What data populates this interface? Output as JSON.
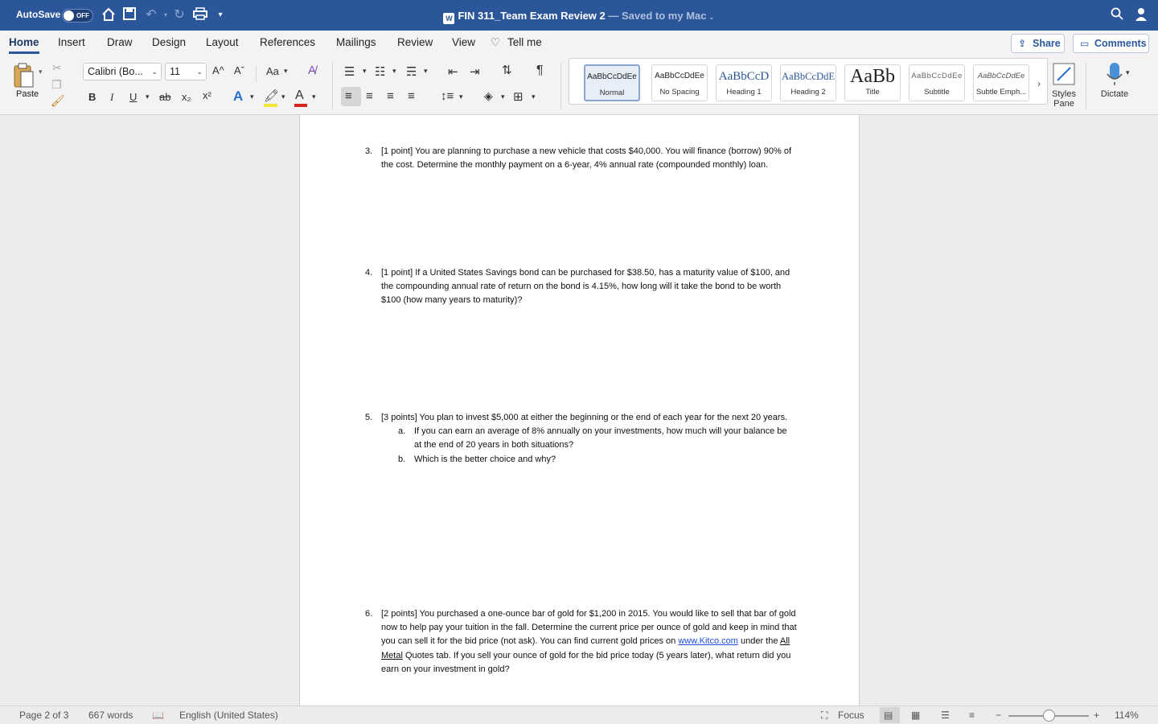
{
  "titlebar": {
    "autosave_label": "AutoSave",
    "toggle_state": "OFF",
    "doc_name": "FIN 311_Team Exam Review 2",
    "doc_status": "— Saved to my Mac",
    "icons": [
      "home-icon",
      "save-icon",
      "undo-icon",
      "redo-icon",
      "print-icon",
      "customize-icon",
      "search-icon",
      "account-icon"
    ]
  },
  "menu": {
    "tabs": [
      "Home",
      "Insert",
      "Draw",
      "Design",
      "Layout",
      "References",
      "Mailings",
      "Review",
      "View",
      "Tell me"
    ],
    "active": "Home",
    "share_label": "Share",
    "comments_label": "Comments"
  },
  "ribbon": {
    "paste_label": "Paste",
    "font_name": "Calibri (Bo...",
    "font_size": "11",
    "grow_font": "A^",
    "shrink_font": "Aˇ",
    "change_case": "Aa",
    "bold": "B",
    "italic": "I",
    "underline": "U",
    "strike": "ab",
    "subscript": "x₂",
    "superscript": "x²",
    "pilcrow": "¶",
    "styles": [
      {
        "sample": "AaBbCcDdEe",
        "name": "Normal"
      },
      {
        "sample": "AaBbCcDdEe",
        "name": "No Spacing"
      },
      {
        "sample": "AaBbCcD",
        "name": "Heading 1"
      },
      {
        "sample": "AaBbCcDdE",
        "name": "Heading 2"
      },
      {
        "sample": "AaBb",
        "name": "Title"
      },
      {
        "sample": "AaBbCcDdEe",
        "name": "Subtitle"
      },
      {
        "sample": "AaBbCcDdEe",
        "name": "Subtle Emph..."
      }
    ],
    "styles_pane_label": "Styles Pane",
    "dictate_label": "Dictate",
    "colors": {
      "accent": "#2b579a",
      "highlight": "#f5e43a",
      "font_color": "#d9261c"
    }
  },
  "document": {
    "q3": {
      "num": "3.",
      "text": "[1 point] You are planning to purchase a new vehicle that costs $40,000.  You will finance (borrow) 90% of the cost.  Determine the monthly payment on a 6-year, 4% annual rate (compounded monthly) loan."
    },
    "q4": {
      "num": "4.",
      "text": "[1 point] If a United States Savings bond can be purchased for $38.50, has a maturity value of $100, and the compounding annual rate of return on the bond is 4.15%, how long will it take the bond to be worth $100 (how many years to maturity)?"
    },
    "q5": {
      "num": "5.",
      "text": "[3 points] You plan to invest $5,000 at either the beginning or the end of each year for the next 20 years.",
      "a_label": "a.",
      "a_text": "If you can earn an average of 8% annually on your investments, how much will your balance be at the end of 20 years in both situations?",
      "b_label": "b.",
      "b_text": "Which is the better choice and why?"
    },
    "q6": {
      "num": "6.",
      "text_part1": "[2 points] You purchased a one-ounce bar of gold for $1,200 in 2015. You would like to sell that bar of gold now to help pay your tuition in the fall. Determine the current price per ounce of gold and keep in mind that you can sell it for the bid price (not ask). You can find current gold prices on",
      "link_text": "www.Kitco.com",
      "text_part2": "under the",
      "underlined_text": "All Metal",
      "text_part3": "Quotes tab. If you sell your ounce of gold for the bid price today (5 years later), what return did you earn on your investment in gold?"
    }
  },
  "statusbar": {
    "page": "Page 2 of 3",
    "words": "667 words",
    "language": "English (United States)",
    "focus_label": "Focus",
    "zoom": "114%"
  }
}
